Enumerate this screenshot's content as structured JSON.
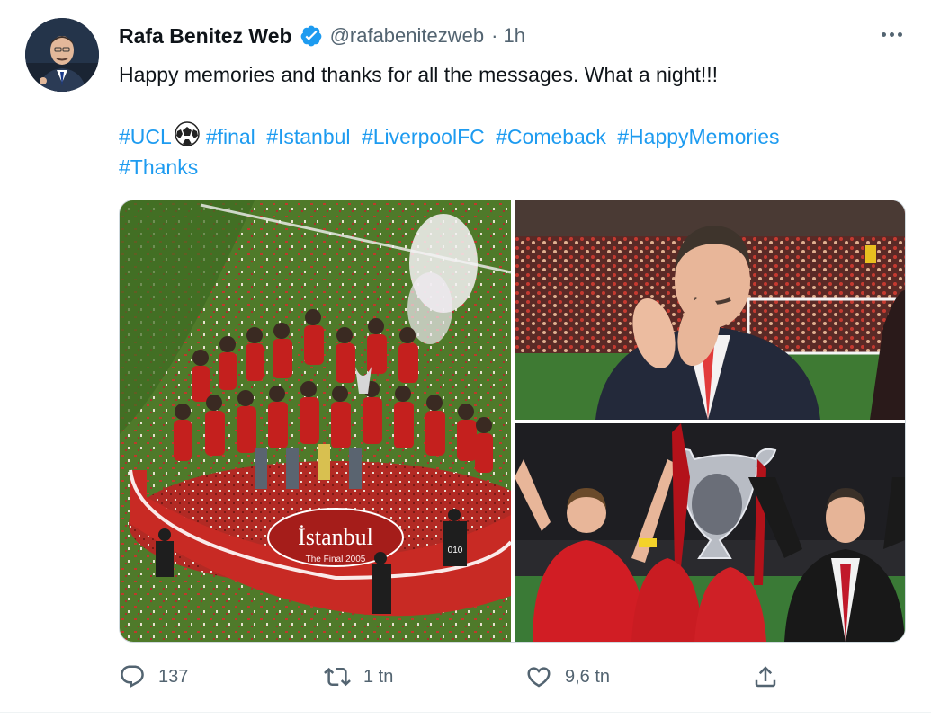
{
  "author": {
    "name": "Rafa Benitez Web",
    "handle": "@rafabenitezweb",
    "time": "· 1h",
    "verified": true
  },
  "tweet": {
    "text": "Happy memories and thanks for all the messages. What a night!!!",
    "hashtags": [
      "#UCL",
      "#final",
      "#Istanbul",
      "#LiverpoolFC",
      "#Comeback",
      "#HappyMemories",
      "#Thanks"
    ]
  },
  "media": {
    "photo1_banner_text": "İstanbul",
    "photo1_banner_sub": "The Final 2005",
    "photo1_player_number": "010"
  },
  "actions": {
    "reply_count": "137",
    "retweet_count": "1 tn",
    "like_count": "9,6 tn"
  },
  "colors": {
    "accent": "#1d9bf0",
    "muted": "#536471",
    "liverpool_red": "#c8102e"
  },
  "icons": [
    "verified-badge-icon",
    "more-options-icon",
    "football-icon",
    "reply-icon",
    "retweet-icon",
    "like-icon",
    "share-icon"
  ]
}
